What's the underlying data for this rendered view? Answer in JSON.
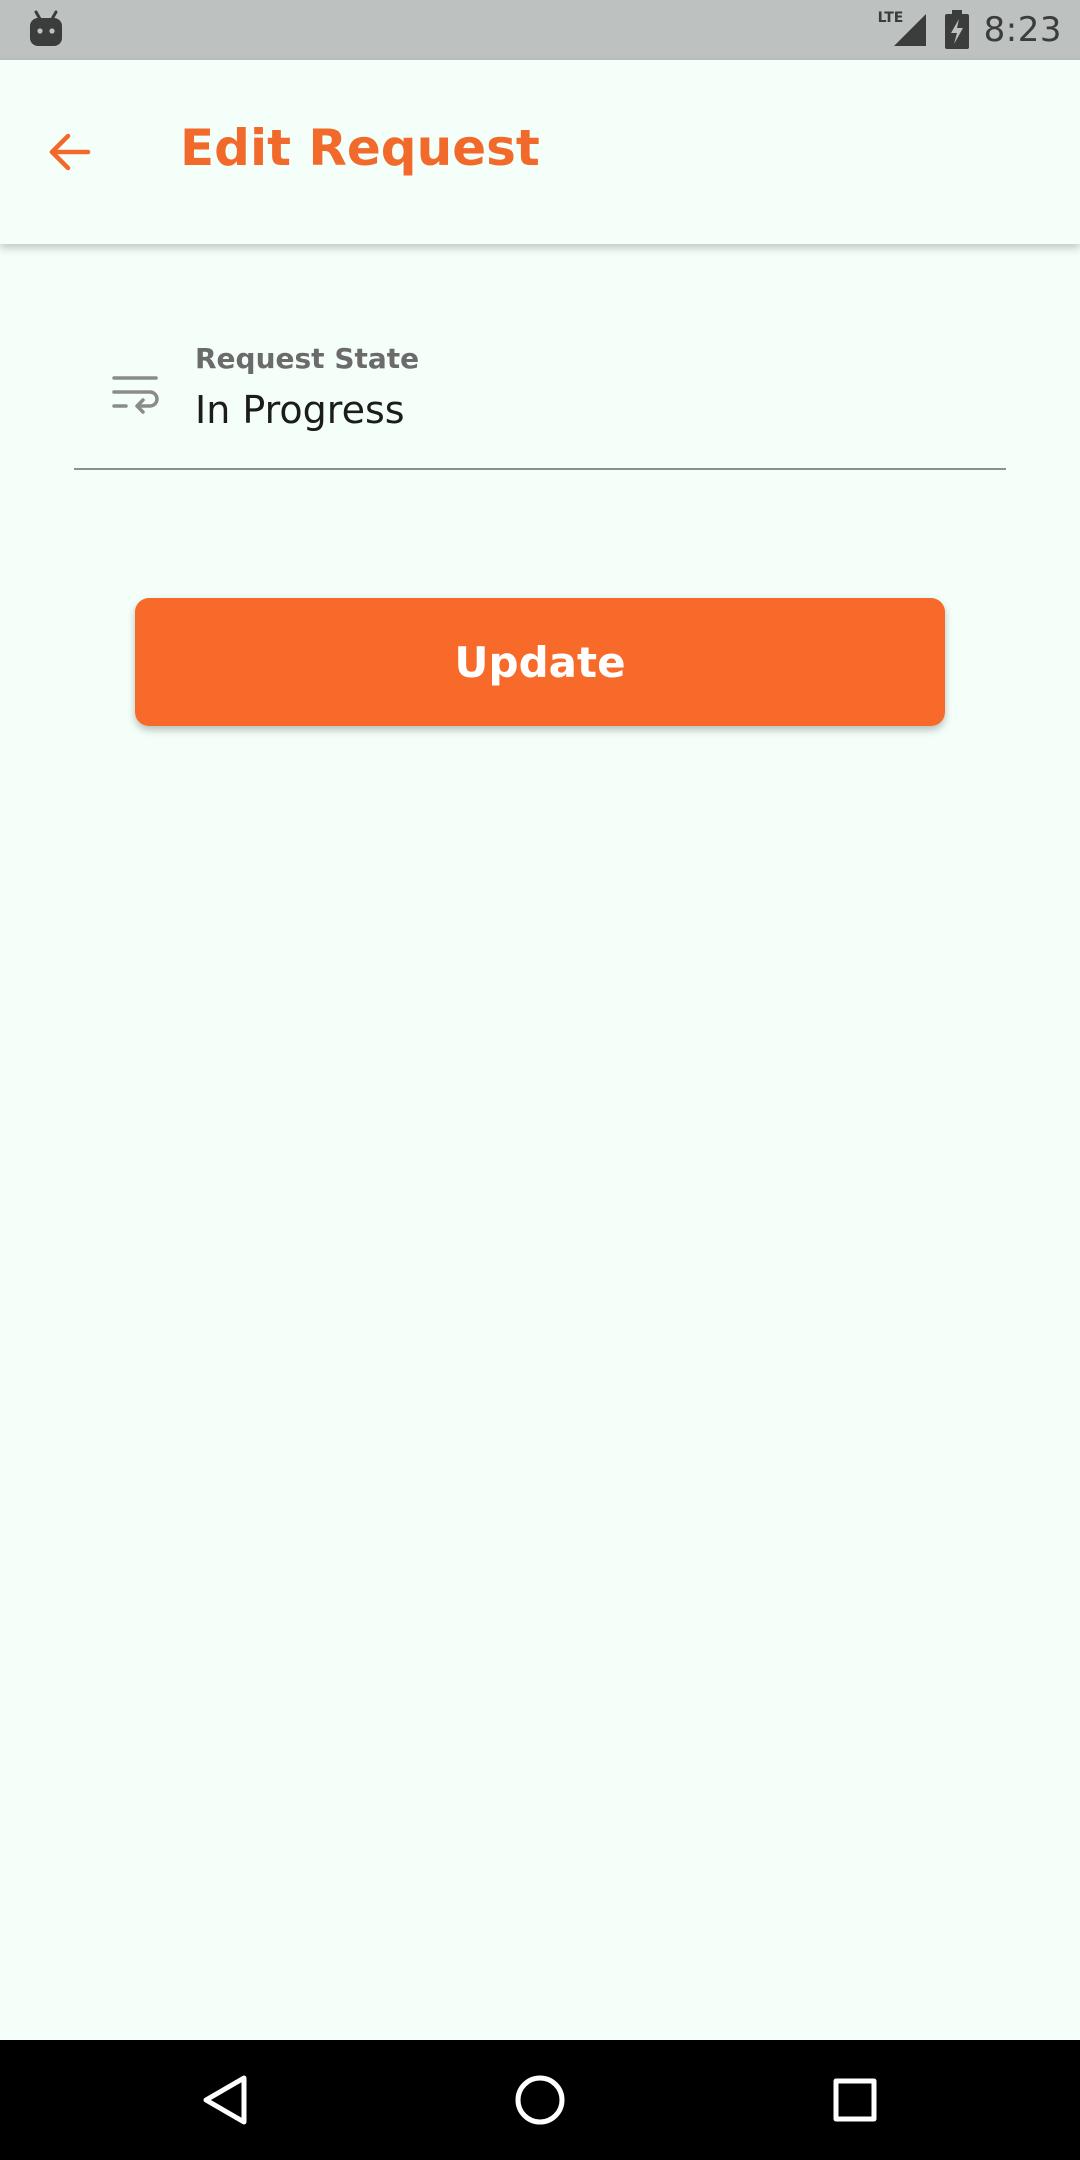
{
  "status_bar": {
    "time": "8:23",
    "network": "LTE",
    "icons": [
      "android-icon",
      "signal-icon",
      "battery-charging-icon"
    ]
  },
  "app_bar": {
    "title": "Edit Request",
    "back_icon": "arrow-left-icon"
  },
  "form": {
    "request_state": {
      "label": "Request State",
      "value": "In Progress",
      "icon": "wrap-text-icon"
    }
  },
  "actions": {
    "update_label": "Update"
  },
  "nav_bar": {
    "icons": [
      "nav-back-icon",
      "nav-home-icon",
      "nav-recents-icon"
    ]
  },
  "colors": {
    "accent": "#F76A29",
    "title": "#F26A2B",
    "background": "#F5FFF9",
    "status_bar": "#BDC1C0"
  }
}
